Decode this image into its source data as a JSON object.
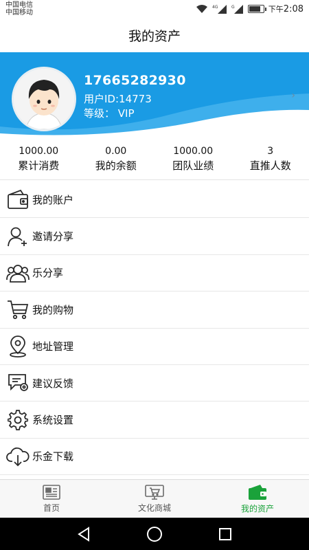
{
  "status_bar": {
    "carrier_1": "中国电信",
    "carrier_2": "中国移动",
    "net_1": "4G",
    "net_2": "G",
    "time_prefix": "下午",
    "time": "2:08",
    "battery_level": 0.85
  },
  "header": {
    "title": "我的资产"
  },
  "profile": {
    "phone": "17665282930",
    "user_id": "用户ID:14773",
    "level": "等级： VIP",
    "chevron": "›",
    "avatar_icon": "boy-avatar-icon"
  },
  "stats": [
    {
      "value": "1000.00",
      "label": "累计消费"
    },
    {
      "value": "0.00",
      "label": "我的余额"
    },
    {
      "value": "1000.00",
      "label": "团队业绩"
    },
    {
      "value": "3",
      "label": "直推人数"
    }
  ],
  "menu": [
    {
      "label": "我的账户",
      "icon": "wallet-icon"
    },
    {
      "label": "邀请分享",
      "icon": "add-user-icon"
    },
    {
      "label": "乐分享",
      "icon": "group-icon"
    },
    {
      "label": "我的购物",
      "icon": "cart-icon"
    },
    {
      "label": "地址管理",
      "icon": "location-pin-icon"
    },
    {
      "label": "建议反馈",
      "icon": "feedback-icon"
    },
    {
      "label": "系统设置",
      "icon": "gear-icon"
    },
    {
      "label": "乐金下载",
      "icon": "cloud-download-icon"
    }
  ],
  "tabs": [
    {
      "label": "首页",
      "icon": "newspaper-icon",
      "active": false
    },
    {
      "label": "文化商城",
      "icon": "shop-monitor-icon",
      "active": false
    },
    {
      "label": "我的资产",
      "icon": "wallet-icon",
      "active": true
    }
  ],
  "colors": {
    "header_blue": "#1a9be4",
    "active_green": "#1aa23a",
    "icon_dark": "#2a2a2a"
  }
}
